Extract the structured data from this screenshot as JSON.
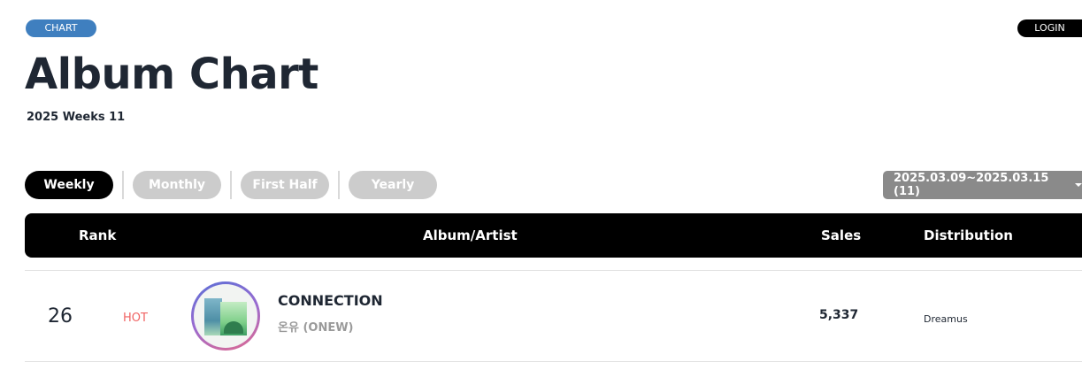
{
  "badge": "CHART",
  "login_label": "LOGIN",
  "page_title": "Album Chart",
  "subtitle": "2025 Weeks 11",
  "tabs": [
    {
      "label": "Weekly",
      "active": true
    },
    {
      "label": "Monthly",
      "active": false
    },
    {
      "label": "First Half",
      "active": false
    },
    {
      "label": "Yearly",
      "active": false
    }
  ],
  "date_range": "2025.03.09~2025.03.15 (11)",
  "table": {
    "headers": {
      "rank": "Rank",
      "album_artist": "Album/Artist",
      "sales": "Sales",
      "distribution": "Distribution"
    },
    "rows": [
      {
        "rank": "26",
        "status": "HOT",
        "album": "CONNECTION",
        "artist": "온유 (ONEW)",
        "sales": "5,337",
        "distribution": "Dreamus"
      }
    ]
  },
  "colors": {
    "badge": "#3f7fbf",
    "tab_active": "#000000",
    "tab_inactive": "#cccccc",
    "hot": "#f06363",
    "header_bg": "#000000",
    "date_select_bg": "#8a8a8a"
  }
}
